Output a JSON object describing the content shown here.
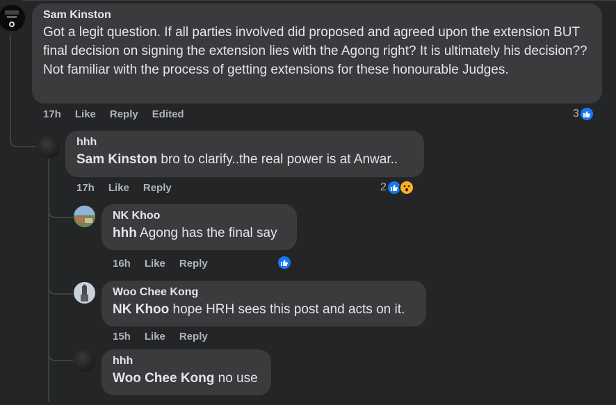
{
  "colors": {
    "background": "#242526",
    "bubble": "#3a3b3c",
    "like": "#1877f2",
    "wow": "#f7b125"
  },
  "comments": [
    {
      "author": "Sam Kinston",
      "mention": "",
      "text": "Got a legit question. If all parties involved did proposed and agreed upon the extension BUT final decision on signing the extension lies with the Agong right? It is ultimately his decision??\nNot familiar with the process of getting extensions for these honourable Judges.",
      "time": "17h",
      "like": "Like",
      "reply": "Reply",
      "edited": "Edited",
      "reaction_count": "3",
      "reactions": [
        "like-icon"
      ]
    },
    {
      "author": "hhh",
      "mention": "Sam Kinston",
      "text": " bro to clarify..the real power is at Anwar..",
      "time": "17h",
      "like": "Like",
      "reply": "Reply",
      "reaction_count": "2",
      "reactions": [
        "like-icon",
        "wow-icon"
      ]
    },
    {
      "author": "NK Khoo",
      "mention": "hhh",
      "text": " Agong has the final say",
      "time": "16h",
      "like": "Like",
      "reply": "Reply",
      "reaction_count": "",
      "reactions": [
        "like-icon"
      ]
    },
    {
      "author": "Woo Chee Kong",
      "mention": "NK Khoo",
      "text": " hope HRH sees this post and acts on it.",
      "time": "15h",
      "like": "Like",
      "reply": "Reply"
    },
    {
      "author": "hhh",
      "mention": "Woo Chee Kong",
      "text": " no use"
    }
  ]
}
